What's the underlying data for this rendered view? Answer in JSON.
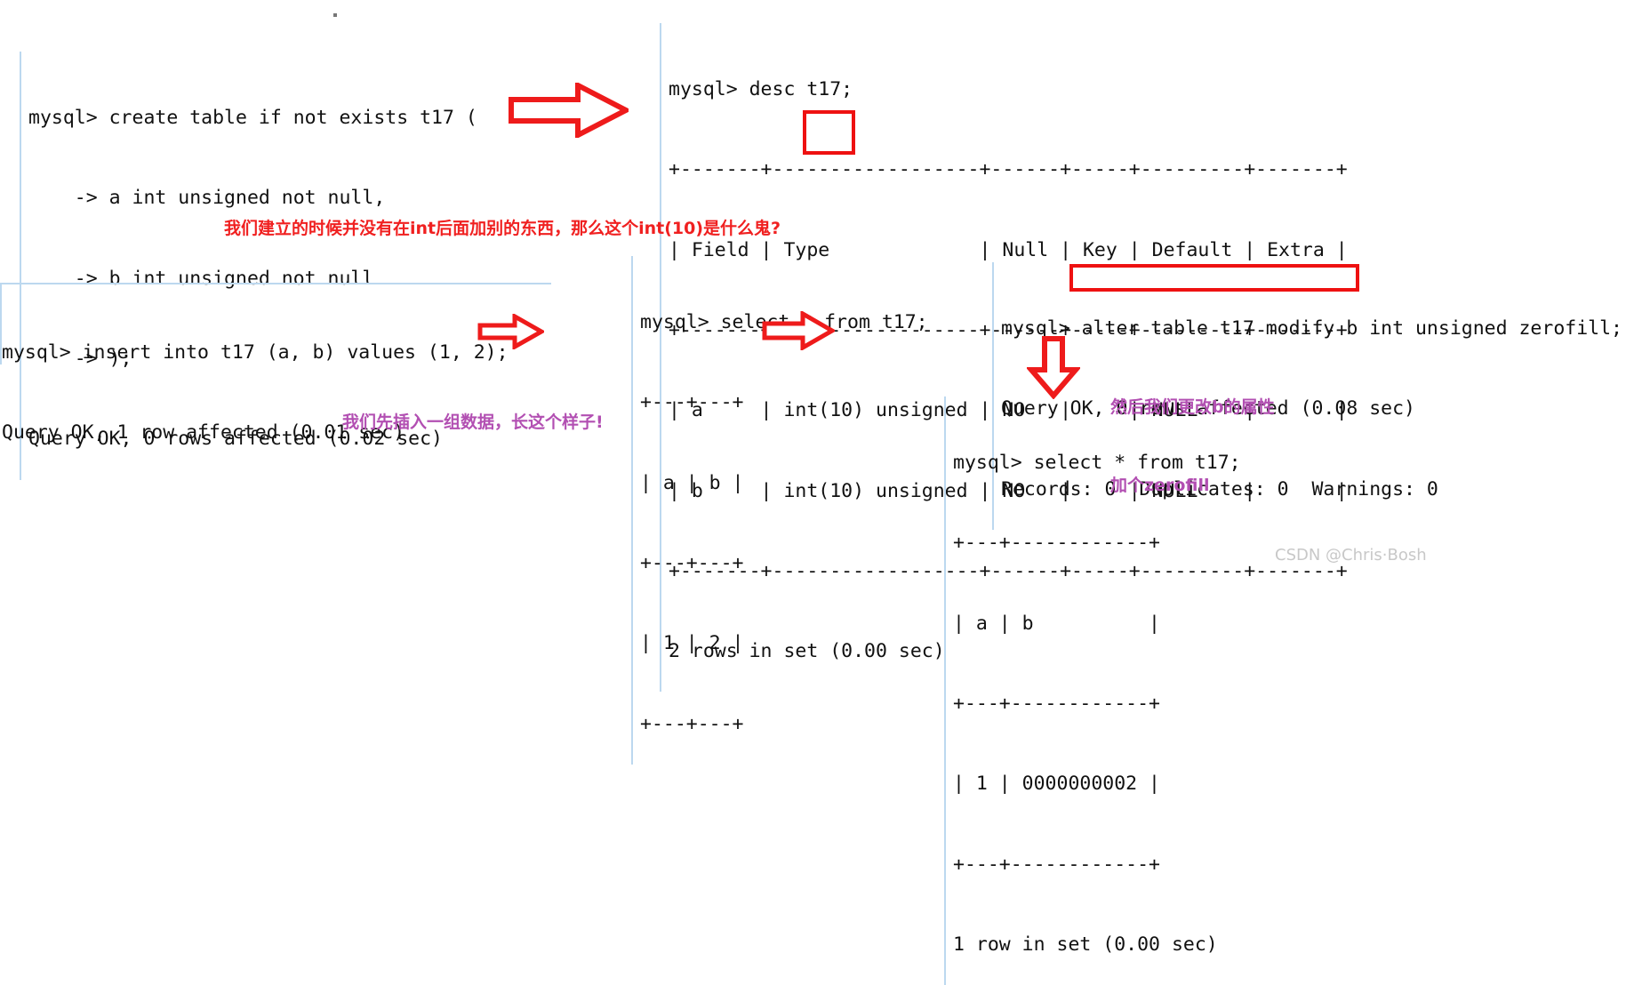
{
  "page": {
    "title": "MySQL int(10) zerofill demonstration",
    "background": "#ffffff",
    "accent_red": "#ee1111",
    "accent_purple": "#b24fb2",
    "terminal_text_color": "#111111",
    "terminal_border_color": "#bcd8ef"
  },
  "terminals": {
    "create_table": {
      "name": "create-table-block",
      "lines": [
        "mysql> create table if not exists t17 (",
        "    -> a int unsigned not null,",
        "    -> b int unsigned not null",
        "    -> );",
        "Query OK, 0 rows affected (0.02 sec)"
      ]
    },
    "desc_table": {
      "name": "desc-table-block",
      "lines": [
        "mysql> desc t17;",
        "+-------+------------------+------+-----+---------+-------+",
        "| Field | Type             | Null | Key | Default | Extra |",
        "+-------+------------------+------+-----+---------+-------+",
        "| a     | int(10) unsigned | NO   |     | NULL    |       |",
        "| b     | int(10) unsigned | NO   |     | NULL    |       |",
        "+-------+------------------+------+-----+---------+-------+",
        "2 rows in set (0.00 sec)"
      ]
    },
    "insert_row": {
      "name": "insert-row-block",
      "lines": [
        "mysql> insert into t17 (a, b) values (1, 2);",
        "Query OK, 1 row affected (0.01 sec)"
      ]
    },
    "select_before": {
      "name": "select-before-block",
      "lines": [
        "mysql> select * from t17;",
        "+---+---+",
        "| a | b |",
        "+---+---+",
        "| 1 | 2 |",
        "+---+---+"
      ]
    },
    "alter_table": {
      "name": "alter-table-block",
      "lines": [
        "mysql> alter table t17 modify b int unsigned zerofill;",
        "Query OK, 0 rows affected (0.08 sec)",
        "Records: 0  Duplicates: 0  Warnings: 0"
      ]
    },
    "select_after": {
      "name": "select-after-block",
      "lines": [
        "mysql> select * from t17;",
        "+---+------------+",
        "| a | b          |",
        "+---+------------+",
        "| 1 | 0000000002 |",
        "+---+------------+",
        "1 row in set (0.00 sec)"
      ]
    }
  },
  "annotations": {
    "red_note": "我们建立的时候并没有在int后面加别的东西，那么这个int(10)是什么鬼?",
    "purple_note_insert": "我们先插入一组数据，长这个样子!",
    "purple_note_alter_line1": "然后我们更改b的属性",
    "purple_note_alter_line2": "加个zerofill"
  },
  "highlights": {
    "int10_box_label": "int(10)",
    "modify_box_label": "modify b int unsigned zerofill;"
  },
  "arrows": {
    "arrow_create_to_desc": "right-arrow-icon",
    "arrow_insert_to_select": "right-arrow-icon",
    "arrow_select_to_alter": "right-arrow-icon",
    "arrow_alter_to_select_after": "down-arrow-icon"
  },
  "watermark": "CSDN @Chris·Bosh"
}
